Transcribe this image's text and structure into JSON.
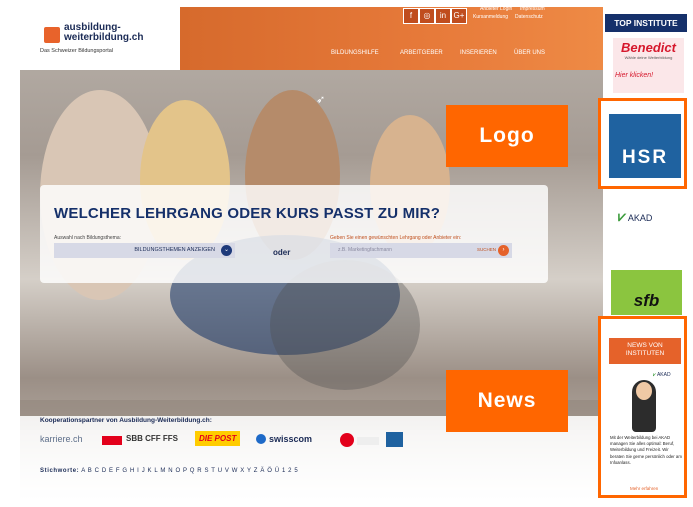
{
  "header": {
    "logo_line1": "ausbildung-",
    "logo_line2": "weiterbildung.ch",
    "logo_sub": "Das Schweizer Bildungsportal",
    "social": [
      "f",
      "◎",
      "in",
      "G+"
    ],
    "top_links": [
      "Anbieter Login",
      "Impressum",
      "Kursanmeldung",
      "Datenschutz"
    ],
    "nav": [
      "BILDUNGSHILFE",
      "ARBEITGEBER",
      "INSERIEREN",
      "ÜBER UNS"
    ]
  },
  "search": {
    "headline": "WELCHER LEHRGANG ODER KURS PASST ZU MIR?",
    "left_label": "Auswahl nach Bildungsthema:",
    "select_value": "BILDUNGSTHEMEN ANZEIGEN",
    "oder": "oder",
    "right_label": "Geben Sie einen gewünschten Lehrgang oder Anbieter ein:",
    "placeholder": "z.B. Marketingfachmann",
    "button": "SUCHEN"
  },
  "footer": {
    "koop_title": "Kooperationspartner von Ausbildung-Weiterbildung.ch:",
    "partners": [
      "karriere.ch",
      "SBB CFF FFS",
      "DIE POST",
      "swisscom"
    ],
    "stichworte_label": "Stichworte:",
    "letters": "A B C D E F G H I J K L M N O P Q R S T U V W X Y Z Ä Ö Ü 1 2 5"
  },
  "sidebar": {
    "top_institute": "TOP INSTITUTE",
    "benedict": "Benedict",
    "benedict_sub": "Wähle deine Weiterbildung",
    "benedict_link": "Hier klicken!",
    "hsr": "HSR",
    "akad": "AKAD",
    "sfb": "sfb",
    "news_title": "NEWS VON INSTITUTEN",
    "news_akad": "AKAD",
    "news_text": "Mit der Weiterbildung bei AKAD managen Sie alles optimal: Beruf, Weiterbildung und Freizeit. Wir beraten Sie gerne persönlich oder am Infoanlass.",
    "news_more": "Mehr erfahren"
  },
  "callouts": {
    "logo": "Logo",
    "news": "News"
  },
  "colors": {
    "accent": "#e5622a",
    "navy": "#15306a",
    "callout": "#ff6600"
  }
}
